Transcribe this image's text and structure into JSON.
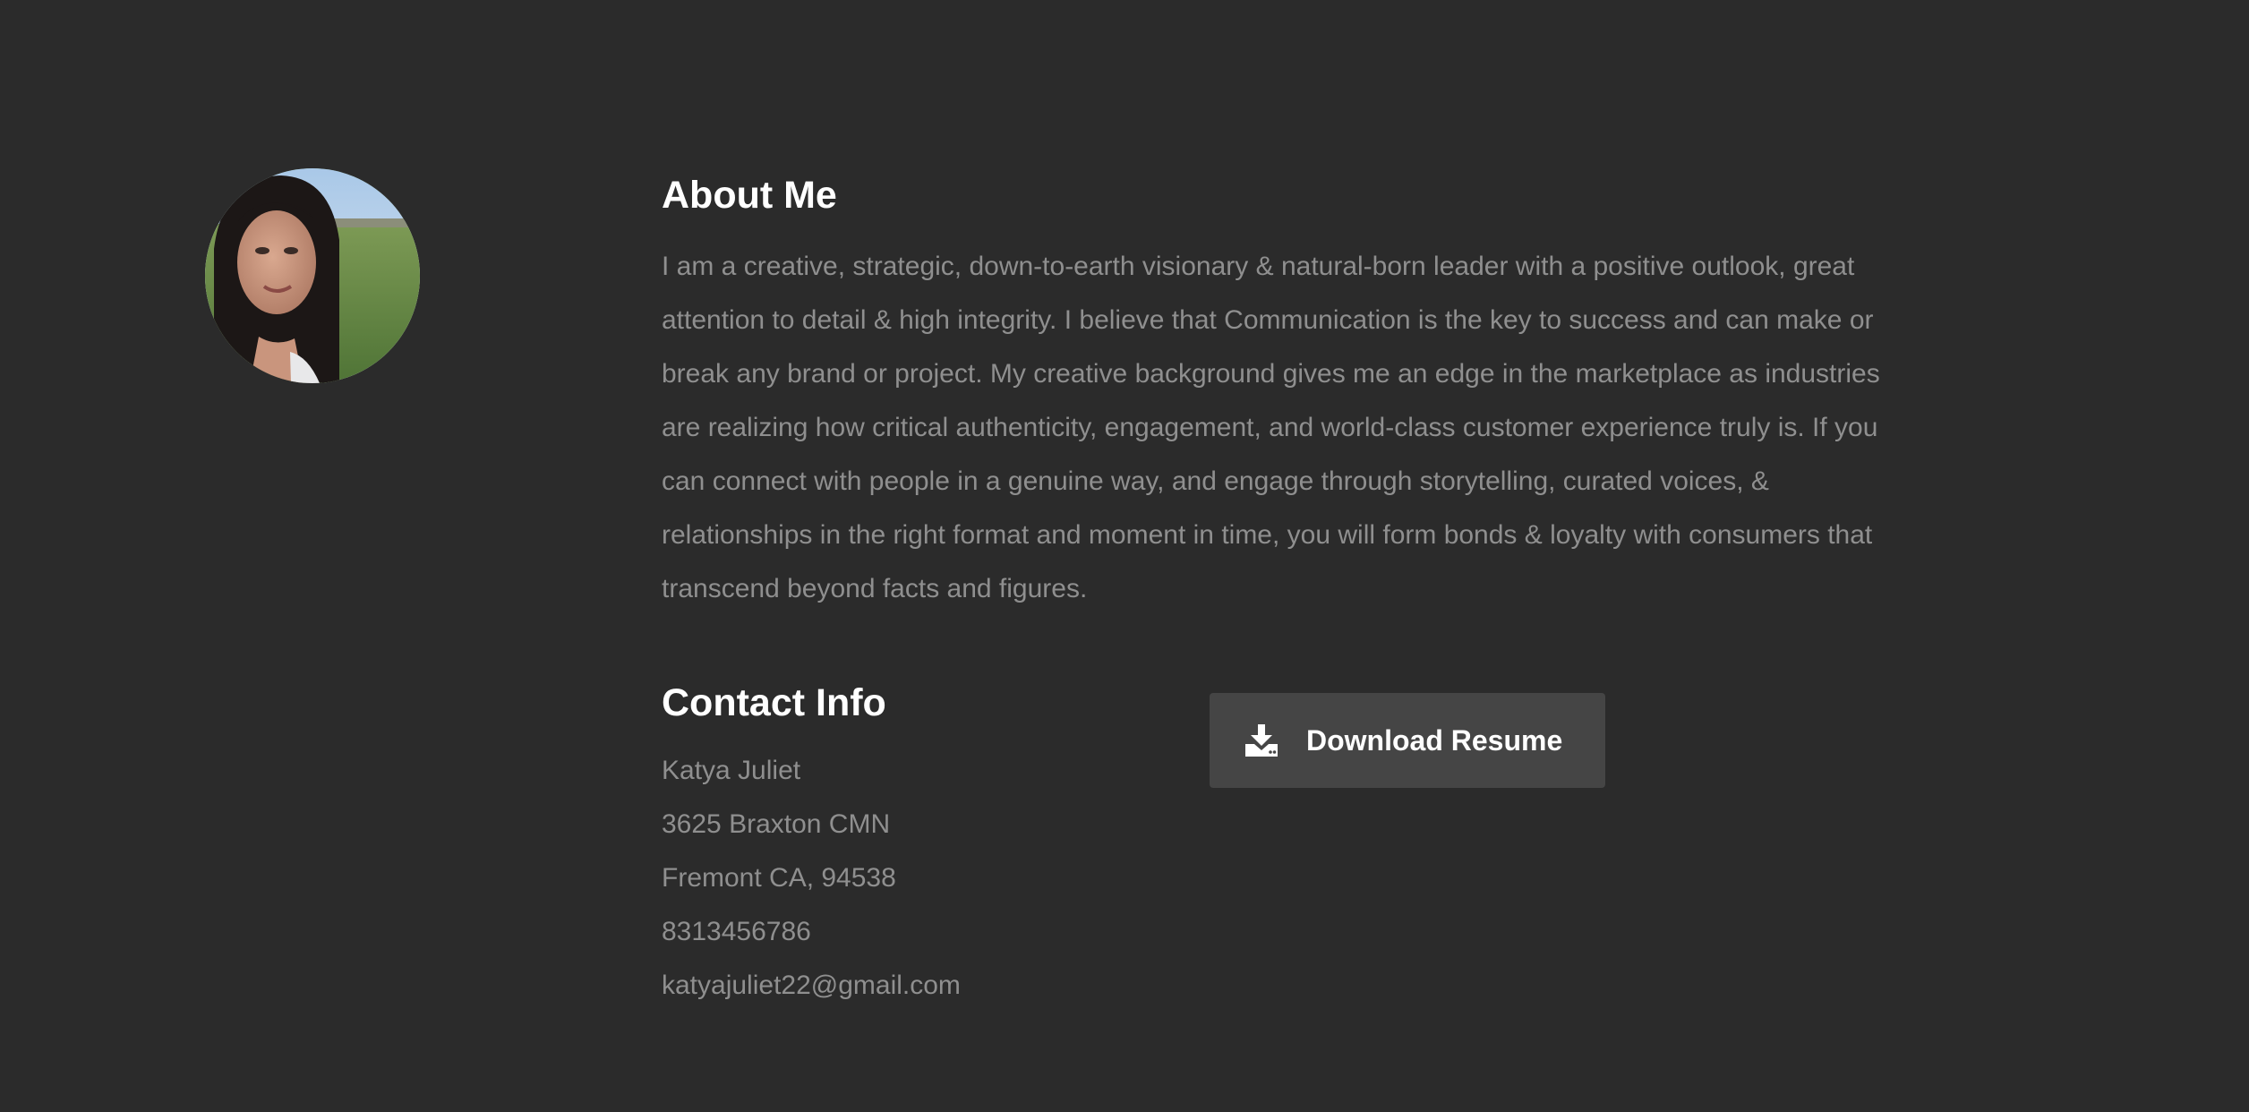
{
  "about": {
    "photo_alt": "profile-photo",
    "heading": "About Me",
    "text": "I am a creative, strategic, down-to-earth visionary & natural-born leader with a positive outlook, great attention to detail & high integrity. I believe that Communication is the key to success and can make or break any brand or project. My creative background gives me an edge in the marketplace as industries are realizing how critical authenticity, engagement, and world-class customer experience truly is. If you can connect with people in a genuine way, and engage through storytelling, curated voices, & relationships in the right format and moment in time, you will form bonds & loyalty with consumers that transcend beyond facts and figures."
  },
  "contact": {
    "heading": "Contact Info",
    "name": "Katya Juliet",
    "street": "3625 Braxton CMN",
    "city": "Fremont CA, 94538",
    "phone": "8313456786",
    "email": "katyajuliet22@gmail.com"
  },
  "download": {
    "label": "Download Resume",
    "icon": "download-icon"
  },
  "colors": {
    "background": "#2b2b2b",
    "heading": "#ffffff",
    "body_text": "#8f8f8f",
    "button_bg": "#454545"
  }
}
